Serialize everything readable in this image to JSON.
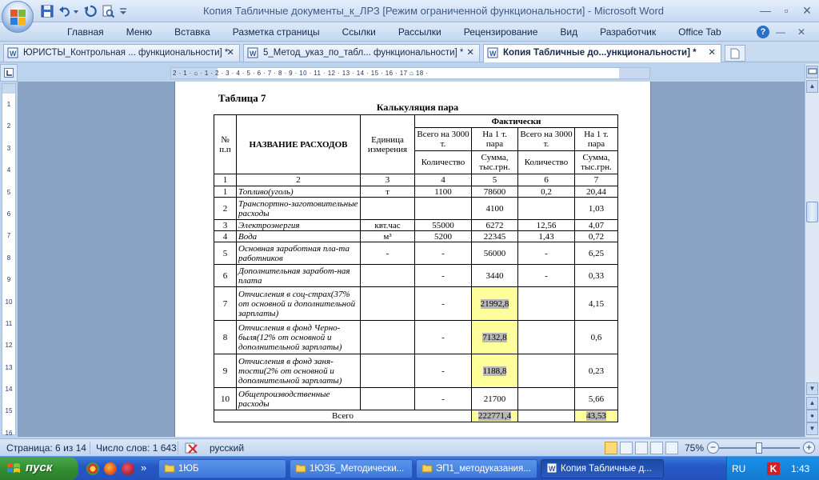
{
  "window": {
    "title": "Копия Табличные документы_к_ЛРЗ [Режим ограниченной функциональности] - Microsoft Word",
    "minimize": "—",
    "maximize": "▫",
    "close": "✕"
  },
  "ribbon": {
    "tabs": [
      "Главная",
      "Меню",
      "Вставка",
      "Разметка страницы",
      "Ссылки",
      "Рассылки",
      "Рецензирование",
      "Вид",
      "Разработчик",
      "Office Tab"
    ],
    "help": "?",
    "minimize": "—",
    "close": "✕"
  },
  "doc_tabs": [
    {
      "label": "ЮРИСТЫ_Контрольная ... функциональности] *",
      "close": "✕"
    },
    {
      "label": "5_Метод_указ_по_табл... функциональности] *",
      "close": "✕"
    },
    {
      "label": "Копия Табличные до...ункциональности] *",
      "close": "✕",
      "active": true
    }
  ],
  "hruler": {
    "labels": "2 · 1 · ⌂ · 1 · 2 · 3 · 4 · 5 · 6 · 7 · 8 · 9 · 10 · 11 · 12 · 13 · 14 · 15 · 16 · 17 ⌂ 18 ·"
  },
  "vruler": {
    "labels": [
      "1",
      "2",
      "3",
      "4",
      "5",
      "6",
      "7",
      "8",
      "9",
      "10",
      "11",
      "12",
      "13",
      "14",
      "15",
      "16"
    ]
  },
  "document": {
    "caption": "Таблица 7",
    "subtitle": "Калькуляция пара",
    "table": {
      "h_num": "№ п.п",
      "h_name": "НАЗВАНИЕ РАСХОДОВ",
      "h_unit": "Единица измерения",
      "h_fact": "Фактически",
      "h_total3000_a": "Всего на 3000 т.",
      "h_per1_a": "На 1 т. пара",
      "h_total3000_b": "Всего на 3000 т.",
      "h_per1_b": "На 1 т. пара",
      "h_qty_a": "Количество",
      "h_sum_a": "Сумма, тыс.грн.",
      "h_qty_b": "Количество",
      "h_sum_b": "Сумма, тыс.грн.",
      "col_numbers": [
        "1",
        "2",
        "3",
        "4",
        "5",
        "6",
        "7"
      ],
      "rows": [
        {
          "n": "1",
          "name": "Топливо(уголь)",
          "unit": "т",
          "q1": "1100",
          "s1": "78600",
          "q2": "0,2",
          "s2": "20,44"
        },
        {
          "n": "2",
          "name": "Транспортно-заготовительные расходы",
          "unit": "",
          "q1": "",
          "s1": "4100",
          "q2": "",
          "s2": "1,03"
        },
        {
          "n": "3",
          "name": "Электроэнергия",
          "unit": "квт.час",
          "q1": "55000",
          "s1": "6272",
          "q2": "12,56",
          "s2": "4,07"
        },
        {
          "n": "4",
          "name": "Вода",
          "unit": "м³",
          "q1": "5200",
          "s1": "22345",
          "q2": "1,43",
          "s2": "0,72"
        },
        {
          "n": "5",
          "name": "Основная заработная пла-та работников",
          "unit": "-",
          "q1": "-",
          "s1": "56000",
          "q2": "-",
          "s2": "6,25"
        },
        {
          "n": "6",
          "name": "Дополнительная заработ-ная плата",
          "unit": "",
          "q1": "-",
          "s1": "3440",
          "q2": "-",
          "s2": "0,33"
        },
        {
          "n": "7",
          "name": "Отчисления в соц-страх(37% от основной и дополнительной зарплаты)",
          "unit": "",
          "q1": "-",
          "s1": "21992,8",
          "q2": "",
          "s2": "4,15",
          "hi": true
        },
        {
          "n": "8",
          "name": "Отчисления в фонд Черно-быля(12% от основной и дополнительной зарплаты)",
          "unit": "",
          "q1": "-",
          "s1": "7132,8",
          "q2": "",
          "s2": "0,6",
          "hi": true
        },
        {
          "n": "9",
          "name": "Отчисления в фонд заня-тости(2% от основной и дополнительной зарплаты)",
          "unit": "",
          "q1": "-",
          "s1": "1188,8",
          "q2": "",
          "s2": "0,23",
          "hi": true
        },
        {
          "n": "10",
          "name": "Общепроизводственные расходы",
          "unit": "",
          "q1": "-",
          "s1": "21700",
          "q2": "",
          "s2": "5,66"
        }
      ],
      "total_label": "Всего",
      "total_sum1": "222771,4",
      "total_sum2": "43,53"
    }
  },
  "status": {
    "page": "Страница: 6 из 14",
    "words": "Число слов: 1 643",
    "language": "русский",
    "zoom": "75%",
    "zoom_level": 0.5
  },
  "taskbar": {
    "start": "пуск",
    "more": "»",
    "tasks": [
      "1ЮБ",
      "1ЮЗБ_Методически...",
      "ЭП1_методуказания...",
      "Копия Табличные д..."
    ],
    "lang": "RU",
    "antivirus": "K",
    "clock": "1:43"
  }
}
